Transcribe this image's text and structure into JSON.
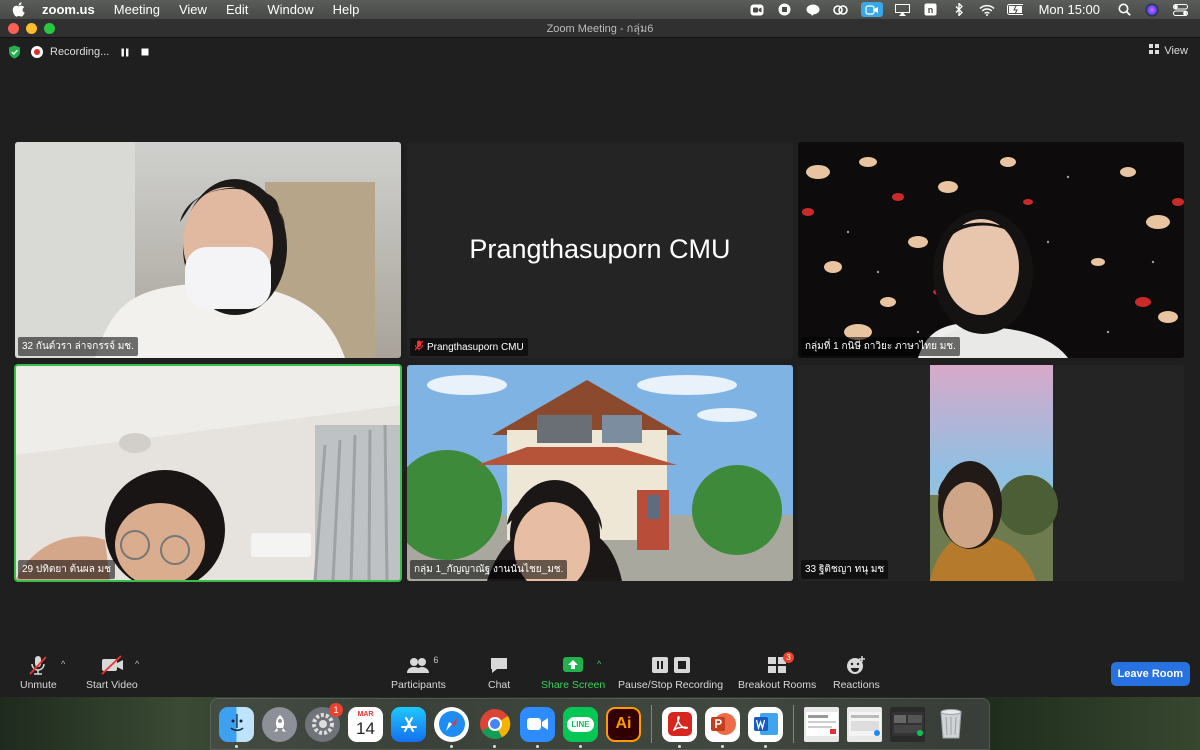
{
  "menubar": {
    "app_name": "zoom.us",
    "items": [
      "Meeting",
      "View",
      "Edit",
      "Window",
      "Help"
    ],
    "clock": "Mon 15:00"
  },
  "window": {
    "title": "Zoom Meeting - กลุ่ม6",
    "recording_label": "Recording...",
    "view_label": "View"
  },
  "participants": [
    {
      "name": "32 กันต์วรา ล่าจกรรจ์ มช.",
      "muted": false,
      "active": false
    },
    {
      "name": "Prangthasuporn CMU",
      "muted": true,
      "active": false,
      "video_off": true
    },
    {
      "name": "กลุ่มที่ 1 กนิษี ถาวิยะ ภาษาไทย มช.",
      "muted": false,
      "active": false
    },
    {
      "name": "29 ปทิตยา ต้นผล มช",
      "muted": false,
      "active": true
    },
    {
      "name": "กลุ่ม 1_กัญญาณัฐ  งานนันไชย_มช.",
      "muted": false,
      "active": false
    },
    {
      "name": "33 ฐิติชญา ทนุ มช",
      "muted": false,
      "active": false
    }
  ],
  "toolbar": {
    "unmute": "Unmute",
    "start_video": "Start Video",
    "participants": "Participants",
    "participants_count": "6",
    "chat": "Chat",
    "share_screen": "Share Screen",
    "recording": "Pause/Stop Recording",
    "breakout": "Breakout Rooms",
    "breakout_badge": "3",
    "reactions": "Reactions",
    "leave": "Leave Room"
  },
  "dock": {
    "calendar_month": "MAR",
    "calendar_day": "14",
    "prefs_badge": "1",
    "line_label": "LINE",
    "ai_label": "Ai"
  },
  "colors": {
    "active_speaker": "#3bbd4a",
    "share_green": "#3bd15a",
    "leave_blue": "#2771e0"
  }
}
